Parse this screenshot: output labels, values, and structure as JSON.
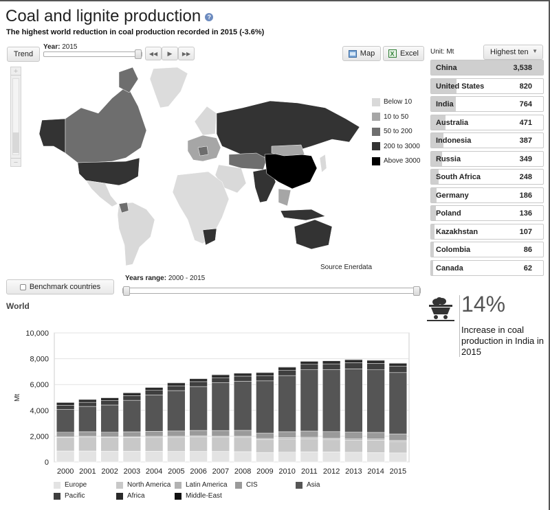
{
  "page": {
    "title": "Coal and lignite production",
    "subtitle": "The highest world reduction in coal production recorded in 2015 (-3.6%)"
  },
  "toolbar": {
    "trend_label": "Trend",
    "year_label": "Year:",
    "year_value": "2015",
    "map_label": "Map",
    "excel_label": "Excel",
    "unit_label": "Unit: Mt",
    "select_value": "Highest ten"
  },
  "map_legend": [
    {
      "label": "Below 10",
      "color": "#d9d9d9"
    },
    {
      "label": "10 to 50",
      "color": "#a6a6a6"
    },
    {
      "label": "50 to 200",
      "color": "#6e6e6e"
    },
    {
      "label": "200 to 3000",
      "color": "#333333"
    },
    {
      "label": "Above 3000",
      "color": "#000000"
    }
  ],
  "map_source": "Source Enerdata",
  "ranking": [
    {
      "country": "China",
      "value": "3,538",
      "fill": 1.0
    },
    {
      "country": "United States",
      "value": "820",
      "fill": 0.23
    },
    {
      "country": "India",
      "value": "764",
      "fill": 0.22
    },
    {
      "country": "Australia",
      "value": "471",
      "fill": 0.13
    },
    {
      "country": "Indonesia",
      "value": "387",
      "fill": 0.11
    },
    {
      "country": "Russia",
      "value": "349",
      "fill": 0.1
    },
    {
      "country": "South Africa",
      "value": "248",
      "fill": 0.07
    },
    {
      "country": "Germany",
      "value": "186",
      "fill": 0.05
    },
    {
      "country": "Poland",
      "value": "136",
      "fill": 0.04
    },
    {
      "country": "Kazakhstan",
      "value": "107",
      "fill": 0.03
    },
    {
      "country": "Colombia",
      "value": "86",
      "fill": 0.025
    },
    {
      "country": "Canada",
      "value": "62",
      "fill": 0.02
    }
  ],
  "benchmark": {
    "label": "Benchmark countries"
  },
  "years_range": {
    "label": "Years range:",
    "value": "2000 - 2015"
  },
  "chart_section": {
    "title": "World"
  },
  "stat": {
    "value": "14%",
    "description": "Increase in coal production in India in 2015"
  },
  "icons": {
    "help": "help-icon",
    "map": "map-icon",
    "excel": "excel-icon",
    "coal": "coal-cart-icon"
  },
  "chart_data": {
    "type": "bar",
    "stacked": true,
    "ylabel": "Mt",
    "ylim": [
      0,
      10000
    ],
    "yticks": [
      "0",
      "2,000",
      "4,000",
      "6,000",
      "8,000",
      "10,000"
    ],
    "grid": true,
    "legend_position": "bottom",
    "categories": [
      "2000",
      "2001",
      "2002",
      "2003",
      "2004",
      "2005",
      "2006",
      "2007",
      "2008",
      "2009",
      "2010",
      "2011",
      "2012",
      "2013",
      "2014",
      "2015"
    ],
    "series": [
      {
        "name": "Europe",
        "color": "#e3e3e3",
        "values": [
          850,
          850,
          840,
          840,
          830,
          820,
          820,
          820,
          800,
          740,
          760,
          790,
          780,
          750,
          730,
          700
        ]
      },
      {
        "name": "North America",
        "color": "#c8c8c8",
        "values": [
          1050,
          1070,
          1040,
          1050,
          1080,
          1090,
          1120,
          1100,
          1110,
          990,
          1040,
          1020,
          950,
          940,
          950,
          870
        ]
      },
      {
        "name": "Latin America",
        "color": "#b2b2b2",
        "values": [
          60,
          65,
          65,
          70,
          75,
          80,
          85,
          90,
          90,
          85,
          95,
          105,
          110,
          110,
          110,
          105
        ]
      },
      {
        "name": "CIS",
        "color": "#9a9a9a",
        "values": [
          340,
          360,
          360,
          380,
          390,
          410,
          420,
          430,
          450,
          420,
          450,
          480,
          510,
          510,
          500,
          500
        ]
      },
      {
        "name": "Asia",
        "color": "#555555",
        "values": [
          1780,
          1960,
          2110,
          2440,
          2810,
          3130,
          3400,
          3700,
          3800,
          4050,
          4350,
          4750,
          4800,
          4900,
          4850,
          4750
        ]
      },
      {
        "name": "Pacific",
        "color": "#3f3f3f",
        "values": [
          310,
          320,
          340,
          350,
          360,
          370,
          380,
          390,
          400,
          410,
          420,
          420,
          450,
          480,
          500,
          490
        ]
      },
      {
        "name": "Africa",
        "color": "#2a2a2a",
        "values": [
          240,
          240,
          240,
          250,
          250,
          250,
          250,
          250,
          250,
          250,
          255,
          255,
          260,
          260,
          260,
          260
        ]
      },
      {
        "name": "Middle-East",
        "color": "#111111",
        "values": [
          2,
          2,
          2,
          2,
          2,
          2,
          2,
          2,
          2,
          2,
          2,
          2,
          2,
          2,
          2,
          2
        ]
      }
    ]
  }
}
